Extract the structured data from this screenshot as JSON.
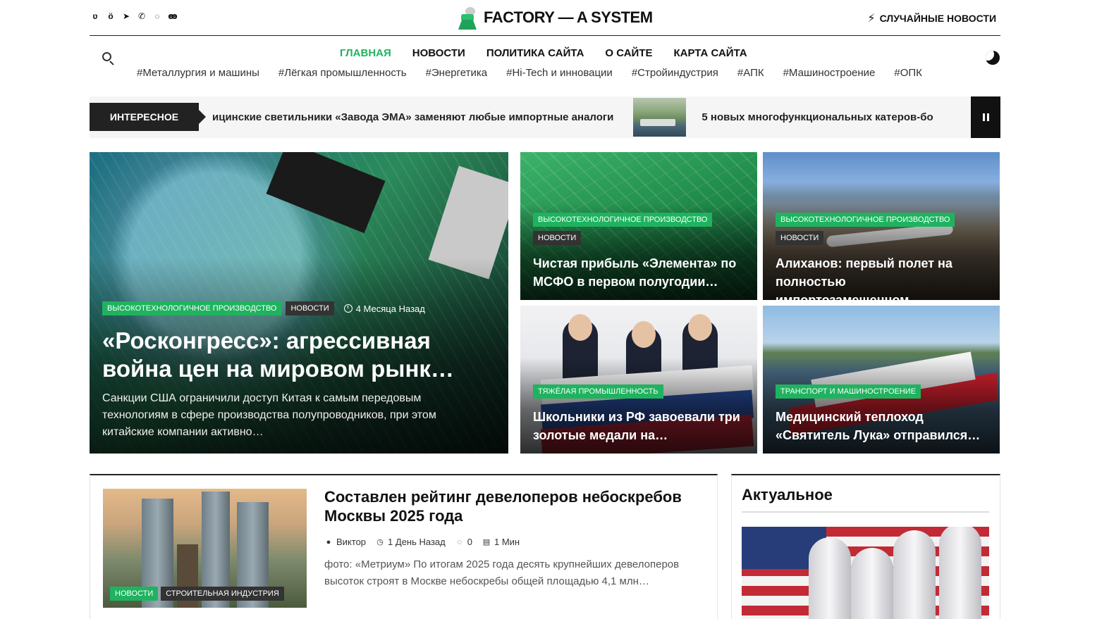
{
  "header": {
    "social_icons": [
      "vk-icon",
      "odnoklassniki-icon",
      "telegram-icon",
      "viber-icon",
      "whatsapp-icon",
      "yandex-zen-icon"
    ],
    "logo_text": "FACTORY — A SYSTEM",
    "random_label": "СЛУЧАЙНЫЕ НОВОСТИ"
  },
  "nav": {
    "menu": [
      "ГЛАВНАЯ",
      "НОВОСТИ",
      "ПОЛИТИКА САЙТА",
      "О САЙТЕ",
      "КАРТА САЙТА"
    ],
    "active": "ГЛАВНАЯ",
    "tags": [
      "#Металлургия и машины",
      "#Лёгкая промышленность",
      "#Энергетика",
      "#Hi-Tech и инновации",
      "#Стройиндустрия",
      "#АПК",
      "#Машиностроение",
      "#ОПК"
    ]
  },
  "ticker": {
    "label": "ИНТЕРЕСНОЕ",
    "items": [
      "ицинские светильники «Завода ЭМА» заменяют любые импортные аналоги",
      "5 новых многофункциональных катеров-бо"
    ]
  },
  "featured": {
    "main": {
      "badges": [
        "ВЫСОКОТЕХНОЛОГИЧНОЕ ПРОИЗВОДСТВО",
        "НОВОСТИ"
      ],
      "time": "4 Месяца Назад",
      "title": "«Росконгресс»: агрессивная война цен на мировом рынк…",
      "excerpt": "Санкции США ограничили доступ Китая к самым передовым технологиям в сфере производства полупроводников, при этом китайские компании активно…"
    },
    "cards": [
      {
        "badges": [
          "ВЫСОКОТЕХНОЛОГИЧНОЕ ПРОИЗВОДСТВО",
          "НОВОСТИ"
        ],
        "title": "Чистая прибыль «Элемента» по МСФО в первом полугодии…"
      },
      {
        "badges": [
          "ВЫСОКОТЕХНОЛОГИЧНОЕ ПРОИЗВОДСТВО",
          "НОВОСТИ"
        ],
        "title": "Алиханов: первый полет на полностью импортозамещенном…"
      },
      {
        "badges": [
          "ТЯЖЁЛАЯ ПРОМЫШЛЕННОСТЬ"
        ],
        "title": "Школьники из РФ завоевали три золотые медали на…"
      },
      {
        "badges": [
          "ТРАНСПОРТ И МАШИНОСТРОЕНИЕ"
        ],
        "title": "Медицинский теплоход «Святитель Лука» отправился…"
      }
    ]
  },
  "post": {
    "badges": [
      "НОВОСТИ",
      "СТРОИТЕЛЬНАЯ ИНДУСТРИЯ"
    ],
    "title": "Составлен рейтинг девелоперов небоскребов Москвы 2025 года",
    "author": "Виктор",
    "time": "1 День Назад",
    "comments": "0",
    "read": "1 Мин",
    "excerpt": "фото: «Метриум» По итогам 2025 года десять крупнейших девелоперов высоток строят в Москве небоскребы общей площадью 4,1 млн…"
  },
  "sidebar": {
    "title": "Актуальное"
  },
  "colors": {
    "accent": "#1fb35f",
    "dark": "#222222"
  }
}
